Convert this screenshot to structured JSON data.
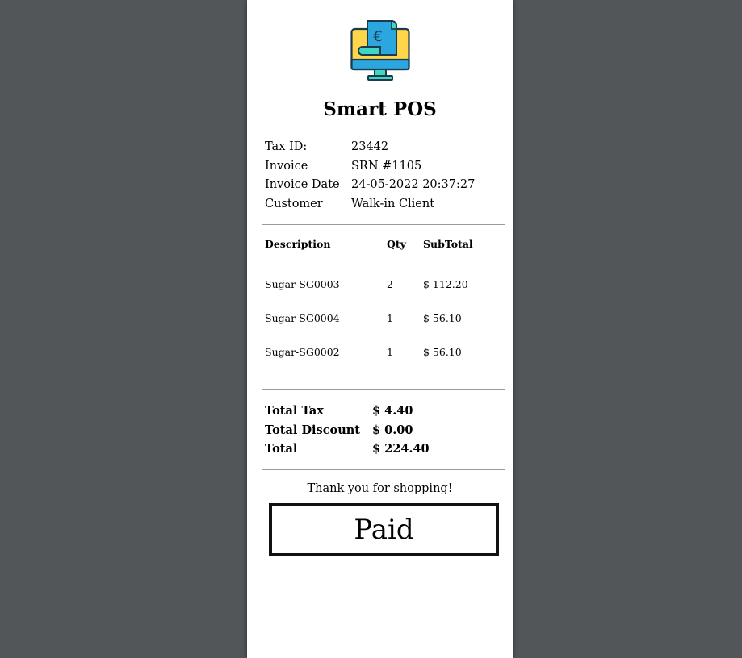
{
  "receipt": {
    "logo_icon": "pos-terminal-euro-icon",
    "brand_name": "Smart POS",
    "meta": [
      {
        "label": "Tax ID:",
        "value": "23442"
      },
      {
        "label": "Invoice",
        "value": "SRN #1105"
      },
      {
        "label": "Invoice Date",
        "value": "24-05-2022 20:37:27"
      },
      {
        "label": "Customer",
        "value": "Walk-in Client"
      }
    ],
    "columns": {
      "description": "Description",
      "qty": "Qty",
      "subtotal": "SubTotal"
    },
    "items": [
      {
        "description": "Sugar-SG0003",
        "qty": "2",
        "subtotal": "$ 112.20"
      },
      {
        "description": "Sugar-SG0004",
        "qty": "1",
        "subtotal": "$ 56.10"
      },
      {
        "description": "Sugar-SG0002",
        "qty": "1",
        "subtotal": "$ 56.10"
      }
    ],
    "totals": [
      {
        "label": "Total Tax",
        "value": "$ 4.40"
      },
      {
        "label": "Total Discount",
        "value": "$ 0.00"
      },
      {
        "label": "Total",
        "value": "$ 224.40"
      }
    ],
    "thank_you": "Thank you for shopping!",
    "status_stamp": "Paid"
  },
  "colors": {
    "viewer_background": "#525659",
    "paper": "#ffffff",
    "logo_screen_yellow": "#ffd54a",
    "logo_screen_blue": "#2ba6de",
    "logo_stand_teal": "#3fd6c5",
    "logo_outline": "#1b3a4b"
  }
}
